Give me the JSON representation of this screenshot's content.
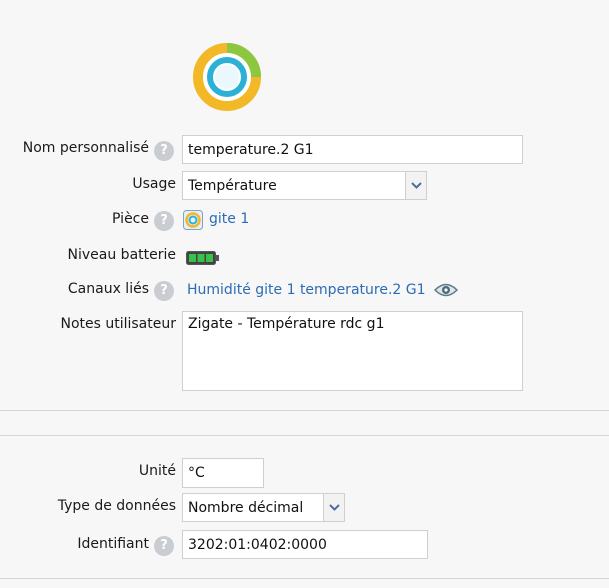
{
  "form": {
    "custom_name": {
      "label": "Nom personnalisé",
      "value": "temperature.2 G1"
    },
    "usage": {
      "label": "Usage",
      "value": "Température"
    },
    "room": {
      "label": "Pièce",
      "value": "gite 1"
    },
    "battery": {
      "label": "Niveau batterie",
      "level_percent": 100
    },
    "linked_channels": {
      "label": "Canaux liés",
      "value": "Humidité gite 1 temperature.2 G1"
    },
    "user_notes": {
      "label": "Notes utilisateur",
      "value": "Zigate - Température rdc g1"
    }
  },
  "details": {
    "unit": {
      "label": "Unité",
      "value": "°C"
    },
    "data_type": {
      "label": "Type de données",
      "value": "Nombre décimal"
    },
    "identifier": {
      "label": "Identifiant",
      "value": "3202:01:0402:0000"
    }
  },
  "colors": {
    "ring_outer": "#f2b825",
    "ring_green": "#8dc63f",
    "ring_inner": "#2bb0d6",
    "link": "#2a6cb6",
    "battery_green": "#2e8b3a"
  }
}
